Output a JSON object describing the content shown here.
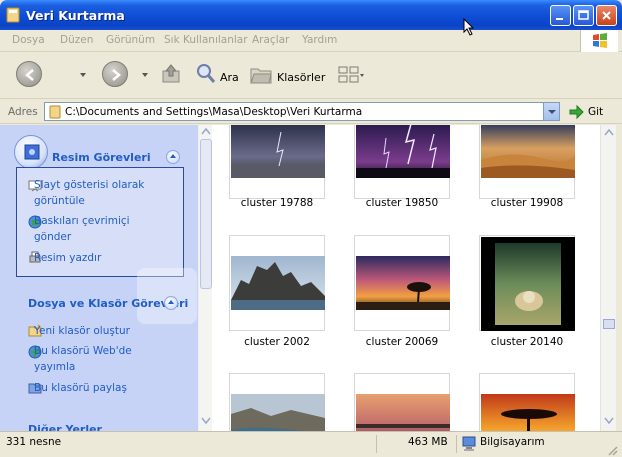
{
  "window": {
    "title": "Veri Kurtarma"
  },
  "menu": [
    "Dosya",
    "Düzen",
    "Görünüm",
    "Sık Kullanılanlar",
    "Araçlar",
    "Yardım"
  ],
  "toolbar": {
    "search_label": "Ara",
    "folders_label": "Klasörler"
  },
  "address": {
    "label": "Adres",
    "path": "C:\\Documents and Settings\\Masa\\Desktop\\Veri Kurtarma",
    "go_label": "Git"
  },
  "picture_tasks": {
    "title": "Resim Görevleri",
    "items": [
      {
        "line1": "Slayt gösterisi olarak",
        "line2": "görüntüle"
      },
      {
        "line1": "Baskıları çevrimiçi",
        "line2": "gönder"
      },
      {
        "line1": "Resim yazdır",
        "line2": ""
      }
    ]
  },
  "file_tasks": {
    "title": "Dosya ve Klasör Görevleri",
    "items": [
      {
        "line1": "Yeni klasör oluştur",
        "line2": ""
      },
      {
        "line1": "Bu klasörü Web'de",
        "line2": "yayımla"
      },
      {
        "line1": "Bu klasörü paylaş",
        "line2": ""
      }
    ]
  },
  "other_places": {
    "title": "Diğer Yerler"
  },
  "files": [
    {
      "name": "cluster 19788"
    },
    {
      "name": "cluster 19850"
    },
    {
      "name": "cluster 19908"
    },
    {
      "name": "cluster 2002"
    },
    {
      "name": "cluster 20069"
    },
    {
      "name": "cluster 20140"
    },
    {
      "name": ""
    },
    {
      "name": ""
    },
    {
      "name": ""
    }
  ],
  "status": {
    "count": "331 nesne",
    "size": "463 MB",
    "location": "Bilgisayarım"
  },
  "colors": {
    "titlebar": "#0F4FD8",
    "task_link": "#215DC6",
    "sidebar_bg": "#C6D3F7"
  }
}
